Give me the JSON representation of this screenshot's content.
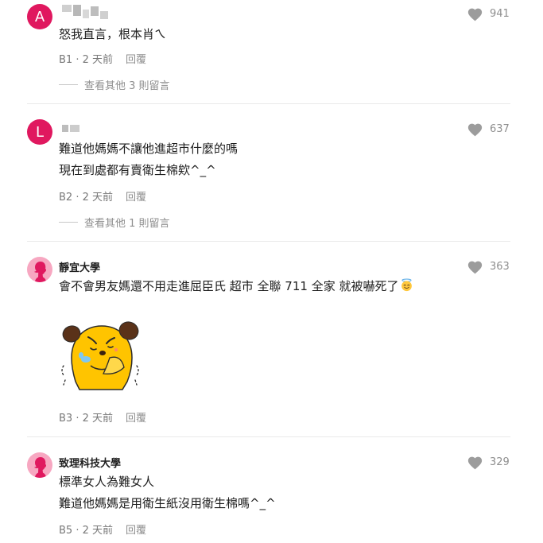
{
  "comments": [
    {
      "avatar_letter": "A",
      "text_lines": [
        "怒我直言，根本肖ㄟ"
      ],
      "floor": "B1",
      "time": "2 天前",
      "reply_label": "回覆",
      "likes": "941",
      "more_replies": "查看其他 3 則留言"
    },
    {
      "avatar_letter": "L",
      "text_lines": [
        "難道他媽媽不讓他進超市什麼的嗎",
        "現在到處都有賣衛生棉欸^_^"
      ],
      "floor": "B2",
      "time": "2 天前",
      "reply_label": "回覆",
      "likes": "637",
      "more_replies": "查看其他 1 則留言"
    },
    {
      "author": "靜宜大學",
      "text_lines": [
        "會不會男友媽還不用走進屈臣氏 超市 全聯 711 全家 就被嚇死了"
      ],
      "emoji": "smiling-face-with-halo",
      "sticker": "yellow-dog-crying-sticker",
      "floor": "B3",
      "time": "2 天前",
      "reply_label": "回覆",
      "likes": "363"
    },
    {
      "author": "致理科技大學",
      "text_lines": [
        "標準女人為難女人",
        "難道他媽媽是用衛生紙沒用衛生棉嗎^_^"
      ],
      "floor": "B5",
      "time": "2 天前",
      "reply_label": "回覆",
      "likes": "329"
    }
  ],
  "icons": {
    "like": "heart-icon",
    "avatar_default": "female-silhouette-icon"
  },
  "colors": {
    "avatar_pink": "#e0185f",
    "avatar_soft": "#f7a7c1",
    "heart": "#9c9c9c",
    "text": "#1f1f1f",
    "meta": "#8e8e8e"
  }
}
